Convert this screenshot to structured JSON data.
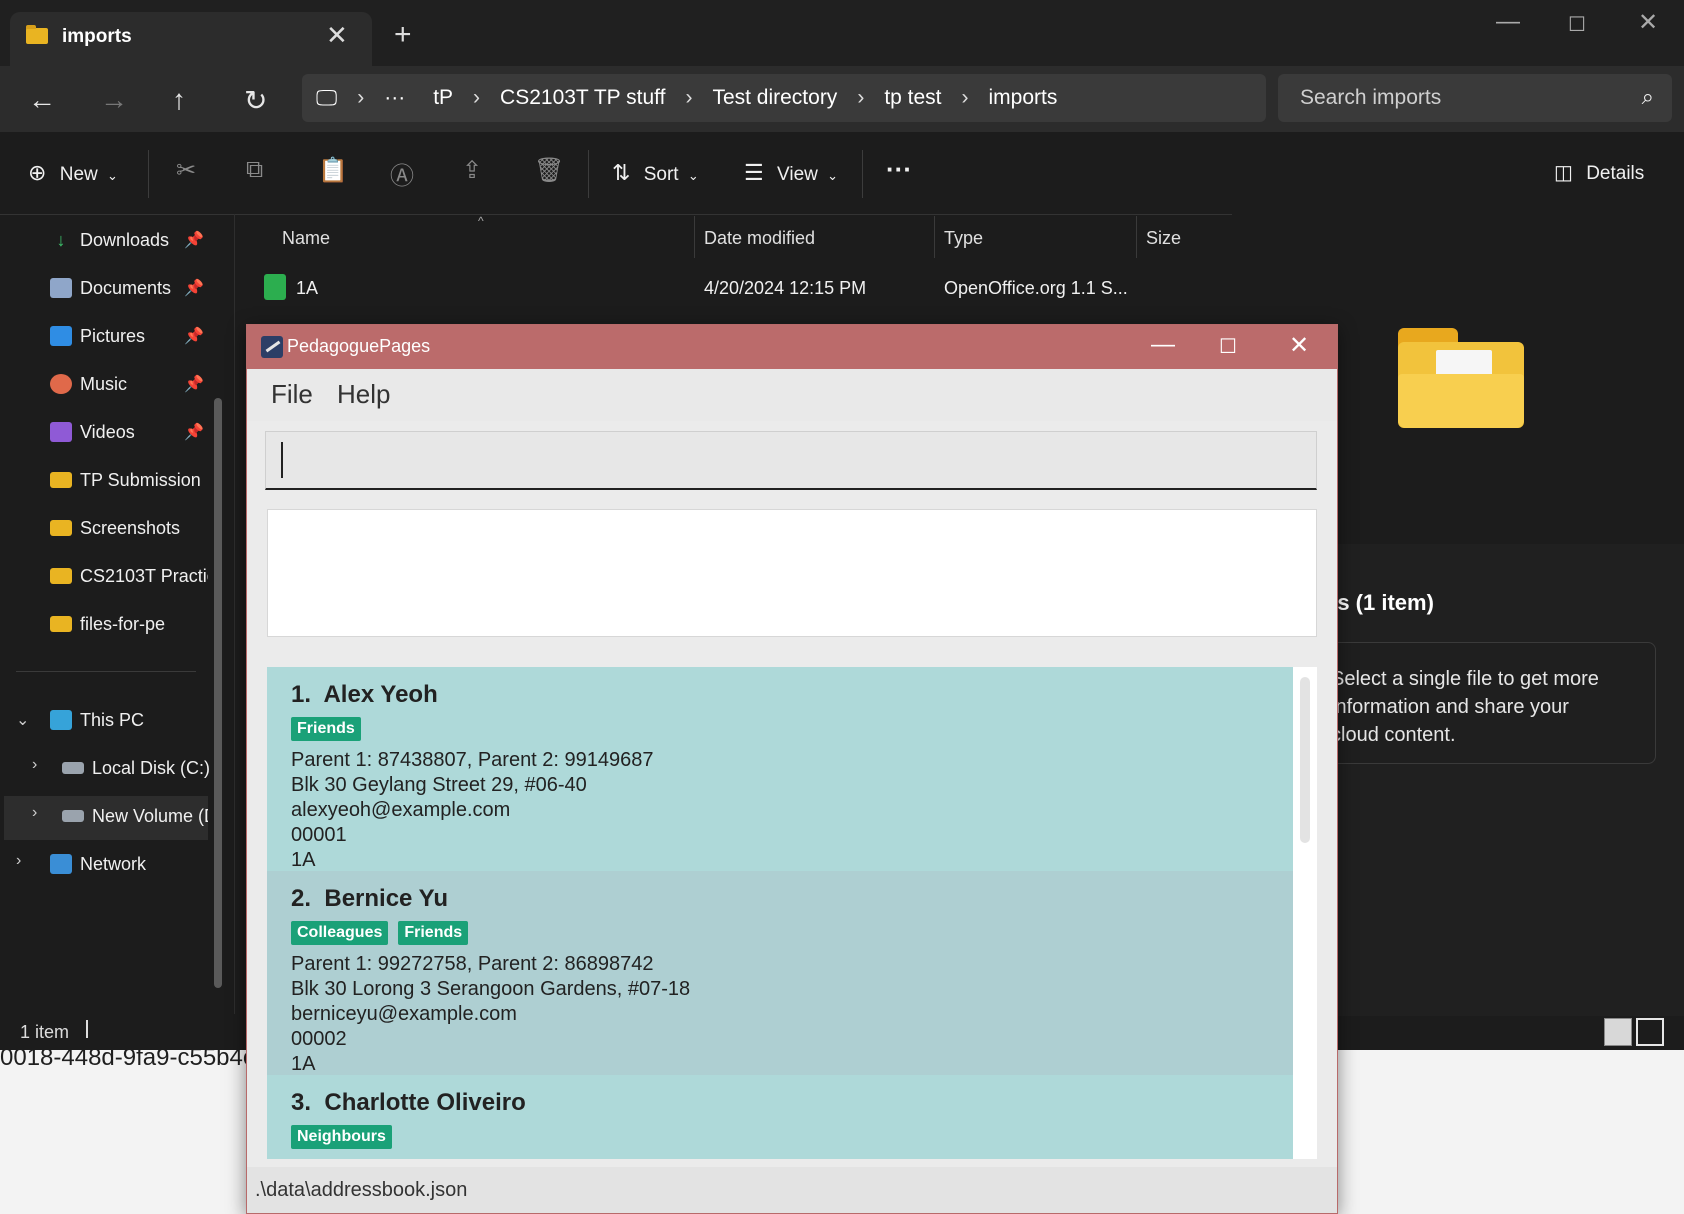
{
  "explorer": {
    "tab_title": "imports",
    "address": {
      "segments": [
        "tP",
        "CS2103T TP stuff",
        "Test directory",
        "tp test",
        "imports"
      ]
    },
    "search_placeholder": "Search imports",
    "toolbar": {
      "new_label": "New",
      "sort_label": "Sort",
      "view_label": "View",
      "details_label": "Details"
    },
    "sidebar": {
      "quick_access": [
        {
          "label": "Downloads",
          "icon": "download-icon"
        },
        {
          "label": "Documents",
          "icon": "documents-icon"
        },
        {
          "label": "Pictures",
          "icon": "pictures-icon"
        },
        {
          "label": "Music",
          "icon": "music-icon"
        },
        {
          "label": "Videos",
          "icon": "videos-icon"
        }
      ],
      "folders": [
        "TP Submission",
        "Screenshots",
        "CS2103T Practic",
        "files-for-pe"
      ],
      "this_pc": "This PC",
      "local_disk": "Local Disk (C:)",
      "new_volume": "New Volume (D",
      "network": "Network"
    },
    "columns": [
      "Name",
      "Date modified",
      "Type",
      "Size"
    ],
    "files": [
      {
        "name": "1A",
        "date": "4/20/2024 12:15 PM",
        "type": "OpenOffice.org 1.1 S...",
        "size": ""
      }
    ],
    "details": {
      "header": "ts (1 item)",
      "message_lines": [
        "Select a single file to get more",
        "information and share your",
        "cloud content."
      ]
    },
    "status": "1 item"
  },
  "background_text": "0018-448d-9fa9-c55b4e",
  "app": {
    "title": "PedagoguePages",
    "menu": [
      "File",
      "Help"
    ],
    "command_value": "",
    "result_text": "",
    "persons": [
      {
        "index": "1.",
        "name": "Alex Yeoh",
        "tags": [
          "Friends"
        ],
        "parents": "Parent 1: 87438807, Parent 2: 99149687",
        "address": "Blk 30 Geylang Street 29, #06-40",
        "email": "alexyeoh@example.com",
        "id": "00001",
        "class": "1A"
      },
      {
        "index": "2.",
        "name": "Bernice Yu",
        "tags": [
          "Colleagues",
          "Friends"
        ],
        "parents": "Parent 1: 99272758, Parent 2: 86898742",
        "address": "Blk 30 Lorong 3 Serangoon Gardens, #07-18",
        "email": "berniceyu@example.com",
        "id": "00002",
        "class": "1A"
      },
      {
        "index": "3.",
        "name": "Charlotte Oliveiro",
        "tags": [
          "Neighbours"
        ]
      }
    ],
    "status_path": ".\\data\\addressbook.json"
  },
  "colors": {
    "title_bar": "#bb6b6b",
    "card_odd": "#aed9d9",
    "card_even": "#aecfd2",
    "tag": "#1aa178"
  }
}
